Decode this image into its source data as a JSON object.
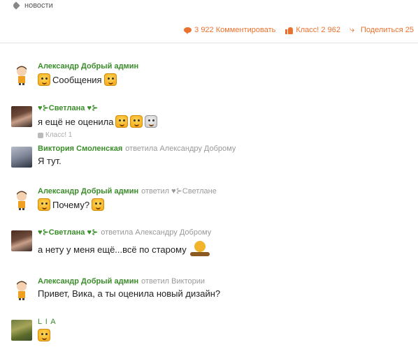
{
  "tag": {
    "label": "новости",
    "icon": "tag-icon"
  },
  "actions": {
    "comment": {
      "label": "3 922 Комментировать",
      "icon": "comment-icon"
    },
    "like": {
      "label": "Класс! 2 962",
      "icon": "like-icon"
    },
    "share": {
      "label": "Поделиться 25",
      "icon": "share-icon"
    }
  },
  "comments": [
    {
      "author": "Александр Добрый админ",
      "reply": "",
      "text": "Сообщения",
      "avatar": "cartoon-avatar"
    },
    {
      "author": "♥⊱Светлана ♥⊱",
      "reply": "",
      "text": "я ещё не оценила",
      "like": "Класс! 1",
      "avatar": "photo-avatar"
    },
    {
      "author": "Виктория Смоленская",
      "reply": "ответила Александру Доброму",
      "text": "Я тут.",
      "avatar": "photo-avatar"
    },
    {
      "author": "Александр Добрый админ",
      "reply": "ответил ♥⊱Светлане",
      "text": "Почему?",
      "avatar": "cartoon-avatar"
    },
    {
      "author": "♥⊱Светлана ♥⊱",
      "reply": "ответила Александру Доброму",
      "text": "а нету у меня ещё...всё по старому",
      "avatar": "photo-avatar"
    },
    {
      "author": "Александр Добрый админ",
      "reply": "ответил Виктории",
      "text": "Привет, Вика, а ты оценила новый дизайн?",
      "avatar": "cartoon-avatar"
    },
    {
      "author": "L I A",
      "reply": "",
      "text": "",
      "avatar": "photo-avatar"
    }
  ]
}
